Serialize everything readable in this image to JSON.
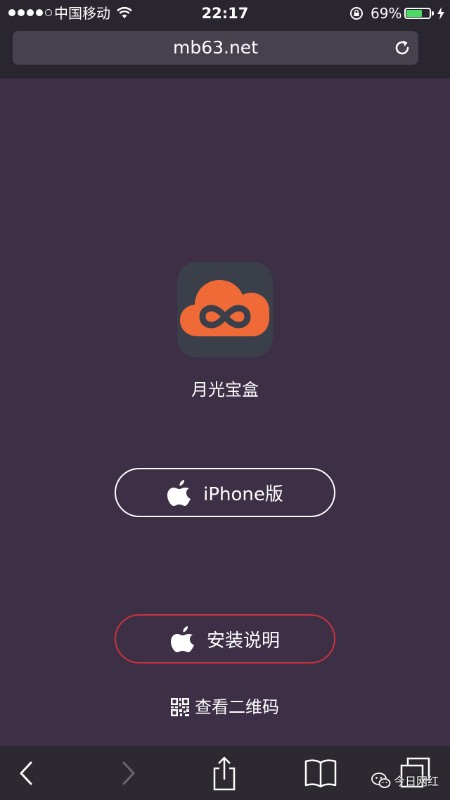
{
  "status_bar": {
    "carrier": "中国移动",
    "time": "22:17",
    "battery_percent_text": "69%",
    "battery_level": 0.69,
    "signal_bars_filled": 4,
    "signal_bars_total": 5
  },
  "address_bar": {
    "url": "mb63.net"
  },
  "app": {
    "name": "月光宝盒",
    "icon": "orange-cloud-infinity-icon",
    "icon_color": "#ef6a36",
    "icon_bg": "#3b3f4a"
  },
  "buttons": {
    "iphone_label": "iPhone版",
    "guide_label": "安装说明",
    "guide_border_color": "#c9343d"
  },
  "qr": {
    "label": "查看二维码"
  },
  "toolbar": {
    "items": [
      "back",
      "forward",
      "share",
      "bookmarks",
      "tabs"
    ]
  },
  "watermark": {
    "text": "今日网红"
  },
  "colors": {
    "background": "#3d2f45",
    "chrome": "#2a2630",
    "battery": "#4cd964"
  }
}
